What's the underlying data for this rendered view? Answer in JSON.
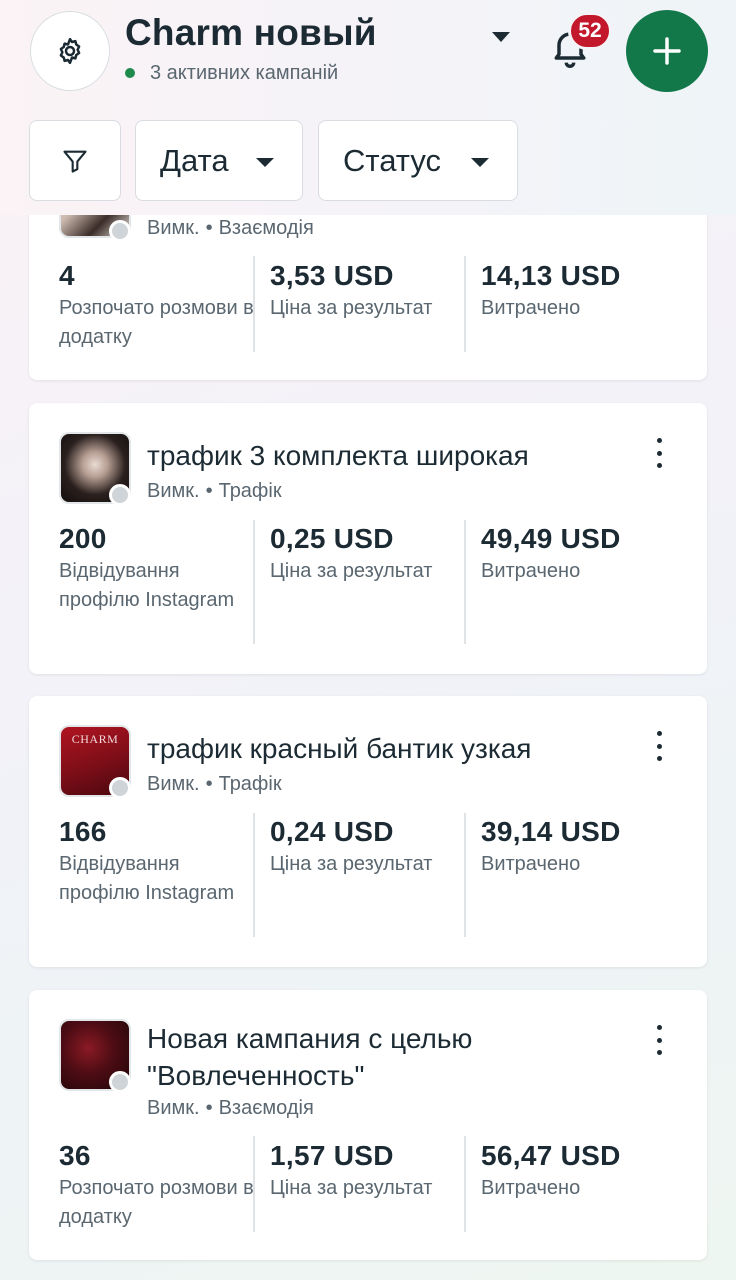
{
  "header": {
    "account_name": "Charm новый",
    "active_campaigns": "3 активних кампаній",
    "notifications_count": "52"
  },
  "filters": {
    "date_label": "Дата",
    "status_label": "Статус"
  },
  "campaigns": [
    {
      "title": "",
      "status": "Вимк.",
      "objective": "Взаємодія",
      "results_value": "4",
      "results_label": "Розпочато розмови в додатку",
      "cpr_value": "3,53 USD",
      "cpr_label": "Ціна за результат",
      "spent_value": "14,13 USD",
      "spent_label": "Витрачено"
    },
    {
      "title": "трафик 3 комплекта широкая",
      "status": "Вимк.",
      "objective": "Трафік",
      "results_value": "200",
      "results_label": "Відвідування профілю Instagram",
      "cpr_value": "0,25 USD",
      "cpr_label": "Ціна за результат",
      "spent_value": "49,49 USD",
      "spent_label": "Витрачено"
    },
    {
      "title": "трафик красный бантик узкая",
      "status": "Вимк.",
      "objective": "Трафік",
      "thumb_text": "CHARM",
      "results_value": "166",
      "results_label": "Відвідування профілю Instagram",
      "cpr_value": "0,24 USD",
      "cpr_label": "Ціна за результат",
      "spent_value": "39,14 USD",
      "spent_label": "Витрачено"
    },
    {
      "title": "Новая кампания с целью \"Вовлеченность\"",
      "status": "Вимк.",
      "objective": "Взаємодія",
      "results_value": "36",
      "results_label": "Розпочато розмови в додатку",
      "cpr_value": "1,57 USD",
      "cpr_label": "Ціна за результат",
      "spent_value": "56,47 USD",
      "spent_label": "Витрачено"
    }
  ],
  "colors": {
    "brand_green": "#12784a",
    "badge_red": "#c3182b",
    "text_primary": "#1c2b33",
    "text_secondary": "#5a6770"
  },
  "icons": [
    "gear-icon",
    "chevron-down-icon",
    "bell-icon",
    "plus-icon",
    "filter-icon",
    "more-vertical-icon"
  ]
}
